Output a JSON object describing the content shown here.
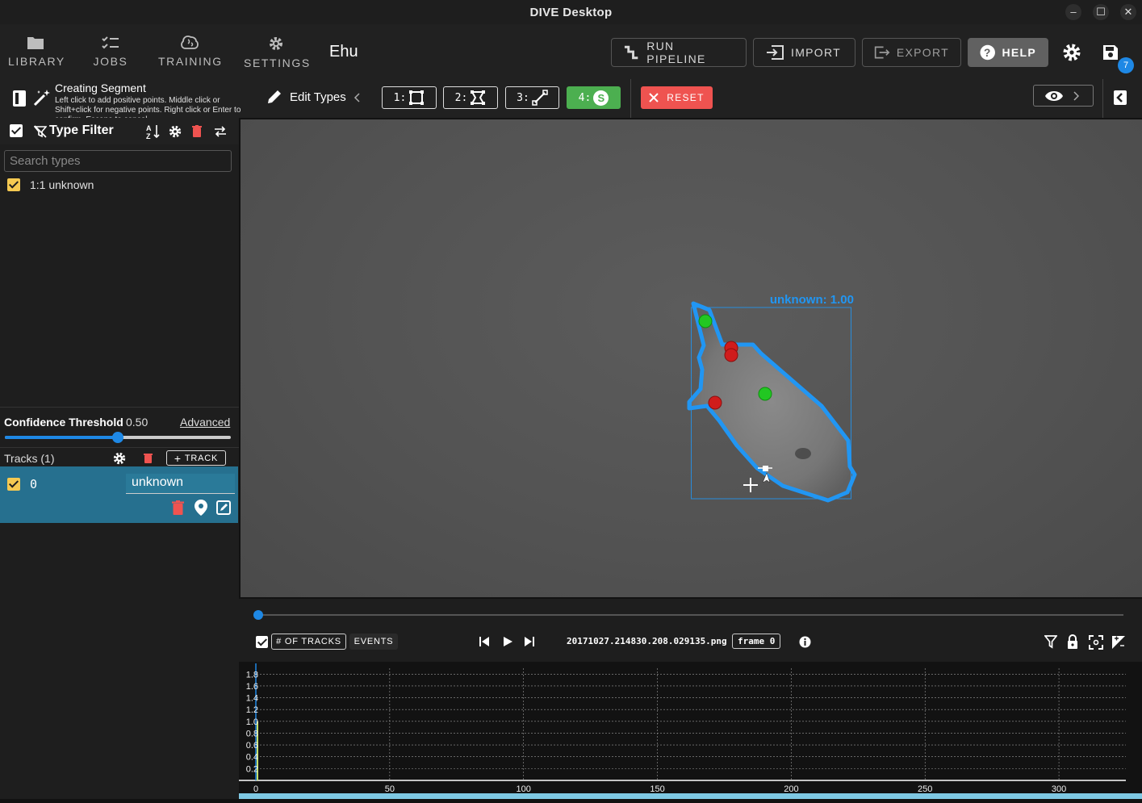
{
  "window": {
    "title": "DIVE Desktop",
    "controls": [
      "–",
      "☐",
      "✕"
    ]
  },
  "nav": [
    {
      "label": "LIBRARY",
      "icon": "folder-icon"
    },
    {
      "label": "JOBS",
      "icon": "list-check-icon"
    },
    {
      "label": "TRAINING",
      "icon": "brain-icon"
    },
    {
      "label": "SETTINGS",
      "icon": "gear-icon"
    }
  ],
  "dataset": {
    "name": "Ehu"
  },
  "actions": {
    "run_pipeline": "RUN PIPELINE",
    "import": "IMPORT",
    "export": "EXPORT",
    "help": "HELP",
    "save_badge": "7"
  },
  "toolbar": {
    "mode_title": "Creating Segment",
    "mode_help": "Left click to add positive points. Middle click or Shift+click for negative points. Right click or Enter to confirm. Escape to cancel.",
    "edit_types": "Edit Types",
    "modes": [
      {
        "label": "1:",
        "icon": "rectangle-icon",
        "active": false
      },
      {
        "label": "2:",
        "icon": "polygon-icon",
        "active": false
      },
      {
        "label": "3:",
        "icon": "line-icon",
        "active": false
      },
      {
        "label": "4:",
        "icon": "segment-icon",
        "badge": "S",
        "active": true
      }
    ],
    "reset": "RESET"
  },
  "type_filter": {
    "title": "Type Filter",
    "search_placeholder": "Search types",
    "types": [
      {
        "label": "1:1 unknown",
        "checked": true,
        "color": "#f5c951"
      }
    ]
  },
  "confidence": {
    "label": "Confidence Threshold",
    "value": "0.50",
    "fraction": 0.5,
    "advanced": "Advanced"
  },
  "tracks": {
    "header": "Tracks (1)",
    "add_label": "TRACK",
    "items": [
      {
        "id": "0",
        "type": "unknown",
        "checked": true
      }
    ]
  },
  "annotation": {
    "label": "unknown: 1.00",
    "color": "#2196f3",
    "positive_points": 2,
    "negative_points": 3
  },
  "playback": {
    "tab_tracks": "# OF TRACKS",
    "tab_events": "EVENTS",
    "filename": "20171027.214830.208.029135.png",
    "frame_label": "frame 0",
    "frame_progress": 0
  },
  "timeline_chart": {
    "y_ticks": [
      "1.8",
      "1.6",
      "1.4",
      "1.2",
      "1.0",
      "0.8",
      "0.6",
      "0.4",
      "0.2"
    ],
    "x_ticks": [
      "0",
      "50",
      "100",
      "150",
      "200",
      "250",
      "300"
    ]
  },
  "chart_data": {
    "type": "line",
    "x": [
      0,
      1
    ],
    "series": [
      {
        "values": [
          1,
          1
        ]
      }
    ],
    "xlim": [
      0,
      325
    ],
    "ylim": [
      0,
      1.9
    ],
    "x_ticks": [
      0,
      50,
      100,
      150,
      200,
      250,
      300
    ],
    "y_ticks": [
      0.2,
      0.4,
      0.6,
      0.8,
      1.0,
      1.2,
      1.4,
      1.6,
      1.8
    ],
    "grid": true,
    "xlabel": "",
    "ylabel": "",
    "title": ""
  }
}
